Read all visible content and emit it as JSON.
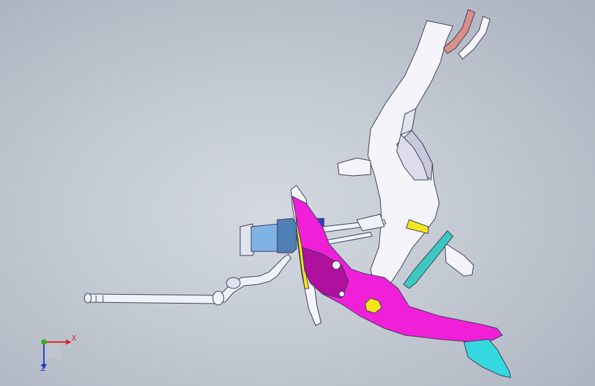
{
  "viewport": {
    "background_top": "#a9b1bd",
    "background_center": "#d4d9e0"
  },
  "model": {
    "colors": {
      "pedal_arm": "#f020d8",
      "pedal_arm_dark": "#b0109e",
      "bracket": "#f4f4fa",
      "bracket_shade": "#d8d8ea",
      "cylinder": "#7fb3e6",
      "cylinder_dark": "#4f7fb5",
      "pad": "#34d9e0",
      "bolt": "#f7e51c",
      "copper_clip": "#d98f8a",
      "pipe": "#eef2fa",
      "green_bar": "#3cc8c0",
      "outline": "#3a3a55"
    }
  },
  "triad": {
    "x_label": "X",
    "z_label": "Z",
    "x_color": "#e0262c",
    "y_color": "#28b428",
    "z_color": "#1e3cc8"
  }
}
